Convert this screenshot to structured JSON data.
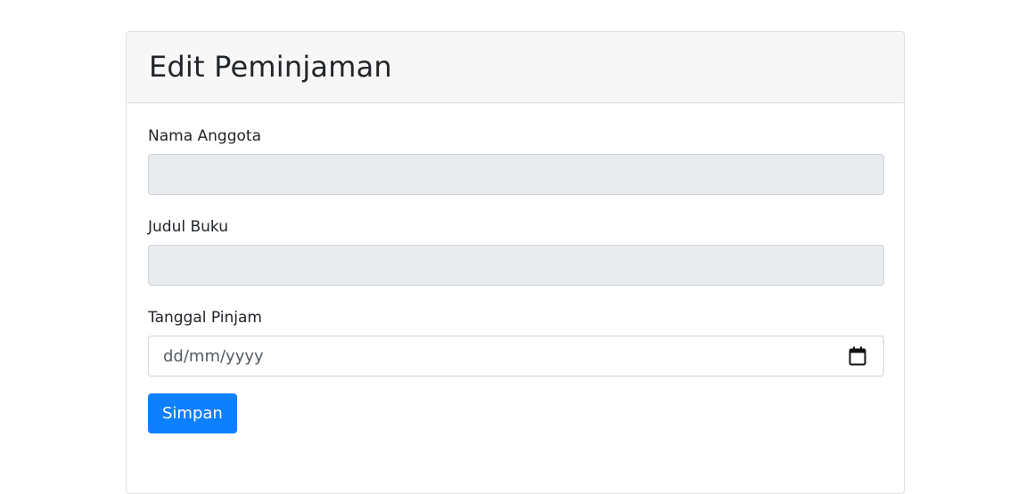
{
  "card": {
    "title": "Edit Peminjaman"
  },
  "form": {
    "member_name": {
      "label": "Nama Anggota",
      "value": ""
    },
    "book_title": {
      "label": "Judul Buku",
      "value": ""
    },
    "loan_date": {
      "label": "Tanggal Pinjam",
      "placeholder": "dd/mm/yyyy",
      "icon": "calendar-icon"
    },
    "submit_label": "Simpan"
  },
  "colors": {
    "primary": "#0d80ff",
    "readonly_bg": "#e9ecef",
    "header_bg": "#f7f7f7"
  }
}
